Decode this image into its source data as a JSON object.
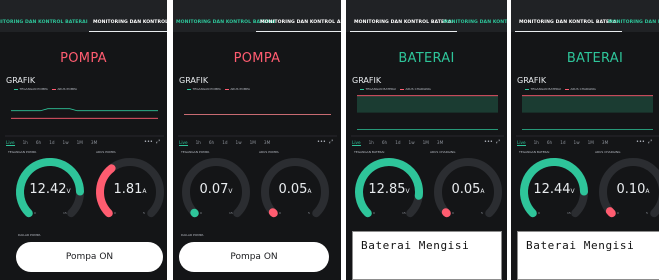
{
  "colors": {
    "panel_bg": "#141517",
    "teal": "#2ec59a",
    "pink": "#ff5c70",
    "track": "#2b2d31",
    "button_bg": "#ffffff"
  },
  "icons": {
    "more": "more-dots-icon",
    "expand": "expand-icon"
  },
  "panels": [
    {
      "tabs": [
        "ONITORING DAN KONTROL BATERAI",
        "MONITORING DAN KONTROL AIR"
      ],
      "active_tab": 1,
      "header": "POMPA",
      "header_color": "pink",
      "grafik_title": "GRAFIK",
      "legend": [
        "TEGANGAN POMPA",
        "ARUS POMPA"
      ],
      "periods": [
        "Live",
        "1h",
        "6h",
        "1d",
        "1w",
        "1M",
        "3M"
      ],
      "gauge_labels": [
        "TEGANGAN POMPA",
        "ARUS POMPA"
      ],
      "gauges": [
        {
          "value": "12.42",
          "unit": "V",
          "fraction": 0.83,
          "min": "0",
          "max": "15",
          "color": "teal"
        },
        {
          "value": "1.81",
          "unit": "A",
          "fraction": 0.36,
          "min": "0",
          "max": "5",
          "color": "pink"
        }
      ],
      "series": [
        0.58,
        0.42
      ],
      "status_label": "DAILAR POMPA",
      "button": "Pompa ON"
    },
    {
      "tabs": [
        "MONITORING DAN KONTROL BATERAI",
        "MONITORING DAN KONTROL AIR"
      ],
      "active_tab": 1,
      "header": "POMPA",
      "header_color": "pink",
      "grafik_title": "GRAFIK",
      "legend": [
        "TEGANGAN POMPA",
        "ARUS POMPA"
      ],
      "periods": [
        "Live",
        "1h",
        "6h",
        "1d",
        "1w",
        "1M",
        "3M"
      ],
      "gauge_labels": [
        "TEGANGAN POMPA",
        "ARUS POMPA"
      ],
      "gauges": [
        {
          "value": "0.07",
          "unit": "V",
          "fraction": 0.005,
          "min": "0",
          "max": "15",
          "color": "teal"
        },
        {
          "value": "0.05",
          "unit": "A",
          "fraction": 0.01,
          "min": "0",
          "max": "5",
          "color": "pink"
        }
      ],
      "series": [
        0.5,
        0.5
      ],
      "status_label": "DAILAR POMPA",
      "button": "Pompa ON"
    },
    {
      "tabs": [
        "MONITORING DAN KONTROL BATERAI",
        "MONITORING DAN KONTROL AIR"
      ],
      "active_tab": 0,
      "header": "BATERAI",
      "header_color": "teal",
      "grafik_title": "GRAFIK",
      "legend": [
        "TEGANGAN BATERAI",
        "ARUS CHARGING"
      ],
      "periods": [
        "Live",
        "1h",
        "6h",
        "1d",
        "1w",
        "1M",
        "3M"
      ],
      "gauge_labels": [
        "TEGANGAN BATERAI",
        "ARUS CHARGING"
      ],
      "gauges": [
        {
          "value": "12.85",
          "unit": "V",
          "fraction": 0.86,
          "min": "0",
          "max": "15",
          "color": "teal"
        },
        {
          "value": "0.05",
          "unit": "A",
          "fraction": 0.01,
          "min": "0",
          "max": "5",
          "color": "pink"
        }
      ],
      "series": [
        0.18,
        0.9
      ],
      "lcd_text": "Baterai Mengisi"
    },
    {
      "tabs": [
        "MONITORING DAN KONTROL BATERAI",
        "MONITORING DAN KONTROL AIR"
      ],
      "active_tab": 0,
      "header": "BATERAI",
      "header_color": "teal",
      "grafik_title": "GRAFIK",
      "legend": [
        "TEGANGAN BATERAI",
        "ARUS CHARGING"
      ],
      "periods": [
        "Live",
        "1h",
        "6h",
        "1d",
        "1w",
        "1M",
        "3M"
      ],
      "gauge_labels": [
        "TEGANGAN BATERAI",
        "ARUS CHARGING"
      ],
      "gauges": [
        {
          "value": "12.44",
          "unit": "V",
          "fraction": 0.83,
          "min": "0",
          "max": "15",
          "color": "teal"
        },
        {
          "value": "0.10",
          "unit": "A",
          "fraction": 0.02,
          "min": "0",
          "max": "5",
          "color": "pink"
        }
      ],
      "series": [
        0.18,
        0.9
      ],
      "lcd_text": "Baterai Mengisi"
    }
  ]
}
